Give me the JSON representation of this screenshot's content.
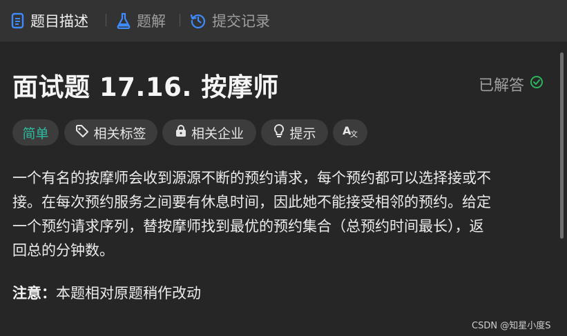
{
  "tabs": [
    {
      "label": "题目描述",
      "icon": "document-icon",
      "active": true
    },
    {
      "label": "题解",
      "icon": "flask-icon",
      "active": false
    },
    {
      "label": "提交记录",
      "icon": "history-icon",
      "active": false
    }
  ],
  "problem": {
    "title": "面试题 17.16. 按摩师",
    "solved_label": "已解答",
    "difficulty": "简单",
    "chips": {
      "related_tags": "相关标签",
      "related_companies": "相关企业",
      "hints": "提示"
    },
    "description_lines": [
      "一个有名的按摩师会收到源源不断的预约请求，每个预约都可以选择接或不",
      "接。在每次预约服务之间要有休息时间，因此她不能接受相邻的预约。给定",
      "一个预约请求序列，替按摩师找到最优的预约集合（总预约时间最长），返",
      "回总的分钟数。"
    ],
    "note_label": "注意：",
    "note_text": "本题相对原题稍作改动"
  },
  "watermark": "CSDN @知星小度S",
  "colors": {
    "background": "#262626",
    "tabbar": "#333333",
    "active_tab_icon": "#3d8bfd",
    "easy": "#2cbb9f",
    "solved_check": "#2db55d",
    "chip_bg": "#3c3c3c"
  }
}
